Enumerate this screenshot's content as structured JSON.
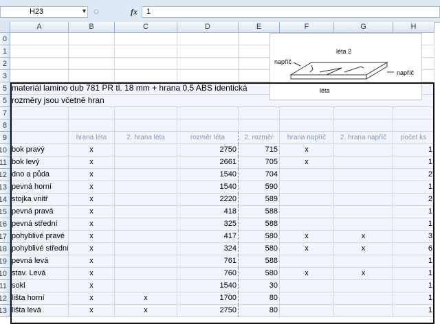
{
  "formula_bar": {
    "name_box": "H23",
    "fx_label": "fx",
    "content": "1"
  },
  "columns": [
    "A",
    "B",
    "C",
    "D",
    "E",
    "F",
    "G",
    "H"
  ],
  "rows": [
    "0",
    "1",
    "2",
    "3",
    "5",
    "5",
    "7",
    "8",
    "9",
    "10",
    "11",
    "12",
    "13",
    "14",
    "15",
    "16",
    "17",
    "18",
    "19",
    "10",
    "11",
    "12",
    "13"
  ],
  "title_lines": [
    "materiál lamino dub 781 PR tl. 18 mm + hrana 0,5 ABS identická",
    "rozměry jsou včetně hran"
  ],
  "table_headers": [
    "hrana léta",
    "2. hrana léta",
    "rozměr léta",
    "2. rozměr",
    "hrana napříč",
    "2. hrana napříč",
    "počet ks"
  ],
  "table_rows": [
    {
      "name": "bok pravý",
      "b": "x",
      "c": "",
      "d": "2750",
      "e": "715",
      "f": "x",
      "g": "",
      "h": "1"
    },
    {
      "name": "bok levý",
      "b": "x",
      "c": "",
      "d": "2661",
      "e": "705",
      "f": "x",
      "g": "",
      "h": "1"
    },
    {
      "name": "dno a půda",
      "b": "x",
      "c": "",
      "d": "1540",
      "e": "704",
      "f": "",
      "g": "",
      "h": "2"
    },
    {
      "name": "pevná horní",
      "b": "x",
      "c": "",
      "d": "1540",
      "e": "590",
      "f": "",
      "g": "",
      "h": "1"
    },
    {
      "name": "stojka vnitř",
      "b": "x",
      "c": "",
      "d": "2220",
      "e": "589",
      "f": "",
      "g": "",
      "h": "2"
    },
    {
      "name": "pevná pravá",
      "b": "x",
      "c": "",
      "d": "418",
      "e": "588",
      "f": "",
      "g": "",
      "h": "1"
    },
    {
      "name": "pevná střední",
      "b": "x",
      "c": "",
      "d": "325",
      "e": "588",
      "f": "",
      "g": "",
      "h": "1"
    },
    {
      "name": "pohyblivé pravé",
      "b": "x",
      "c": "",
      "d": "417",
      "e": "580",
      "f": "x",
      "g": "x",
      "h": "3"
    },
    {
      "name": "pohyblivé střední",
      "b": "x",
      "c": "",
      "d": "324",
      "e": "580",
      "f": "x",
      "g": "x",
      "h": "6"
    },
    {
      "name": "pevná levá",
      "b": "x",
      "c": "",
      "d": "761",
      "e": "588",
      "f": "",
      "g": "",
      "h": "1"
    },
    {
      "name": "stav. Levá",
      "b": "x",
      "c": "",
      "d": "760",
      "e": "580",
      "f": "x",
      "g": "x",
      "h": "1"
    },
    {
      "name": "sokl",
      "b": "x",
      "c": "",
      "d": "1540",
      "e": "30",
      "f": "",
      "g": "",
      "h": "1"
    },
    {
      "name": "lišta horní",
      "b": "x",
      "c": "x",
      "d": "1700",
      "e": "80",
      "f": "",
      "g": "",
      "h": "1"
    },
    {
      "name": "lišta levá",
      "b": "x",
      "c": "x",
      "d": "2750",
      "e": "80",
      "f": "",
      "g": "",
      "h": "1"
    }
  ],
  "diagram": {
    "label_top": "léta 2",
    "label_left": "napříč",
    "label_right": "napříč",
    "label_bottom": "léta"
  }
}
